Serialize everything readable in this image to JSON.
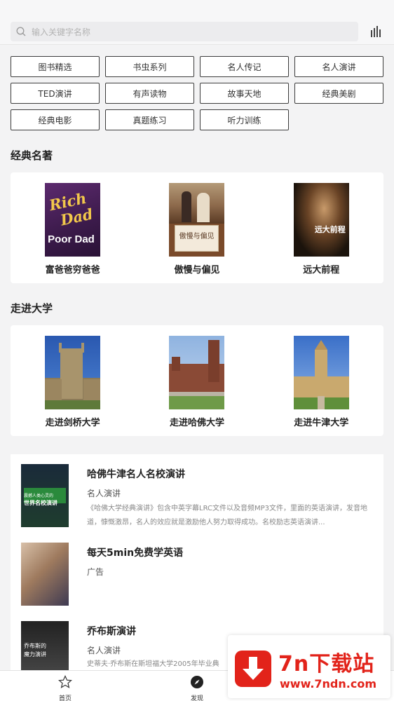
{
  "search": {
    "placeholder": "输入关键字名称"
  },
  "categories": [
    "图书精选",
    "书虫系列",
    "名人传记",
    "名人演讲",
    "TED演讲",
    "有声读物",
    "故事天地",
    "经典美剧",
    "经典电影",
    "真题练习",
    "听力训练"
  ],
  "sections": {
    "classics": {
      "title": "经典名著",
      "books": [
        {
          "title": "富爸爸穷爸爸",
          "cover_lines": [
            "Rich",
            "Dad",
            "Poor Dad"
          ]
        },
        {
          "title": "傲慢与偏见",
          "cover_lines": [
            "傲慢与偏见"
          ]
        },
        {
          "title": "远大前程",
          "cover_lines": [
            "远大前程"
          ]
        }
      ]
    },
    "university": {
      "title": "走进大学",
      "books": [
        {
          "title": "走进剑桥大学"
        },
        {
          "title": "走进哈佛大学"
        },
        {
          "title": "走进牛津大学"
        }
      ]
    }
  },
  "feed": [
    {
      "title": "哈佛牛津名人名校演讲",
      "category": "名人演讲",
      "description": "《哈佛大学经典演讲》包含中英字幕LRC文件以及音频MP3文件，里面的英语演讲，发音地道，慷慨激昂，名人的效应就是激励他人努力取得成功。名校励志英语演讲...",
      "thumb_lines": [
        "震撼人类心灵的",
        "世界名校演讲"
      ]
    },
    {
      "title": "每天5min免费学英语",
      "category": "广告",
      "description": ""
    },
    {
      "title": "乔布斯演讲",
      "category": "名人演讲",
      "description": "史蒂夫·乔布斯在斯坦福大学2005年毕业典",
      "thumb_lines": [
        "乔布斯的",
        "魔力演讲"
      ]
    }
  ],
  "tabbar": {
    "home": "首页",
    "discover": "发现"
  },
  "watermark": {
    "name": "7n下载站",
    "url": "www.7ndn.com"
  },
  "colors": {
    "accent": "#e2231a",
    "tag_border": "#3c3c3c",
    "background": "#f3f3f4"
  }
}
